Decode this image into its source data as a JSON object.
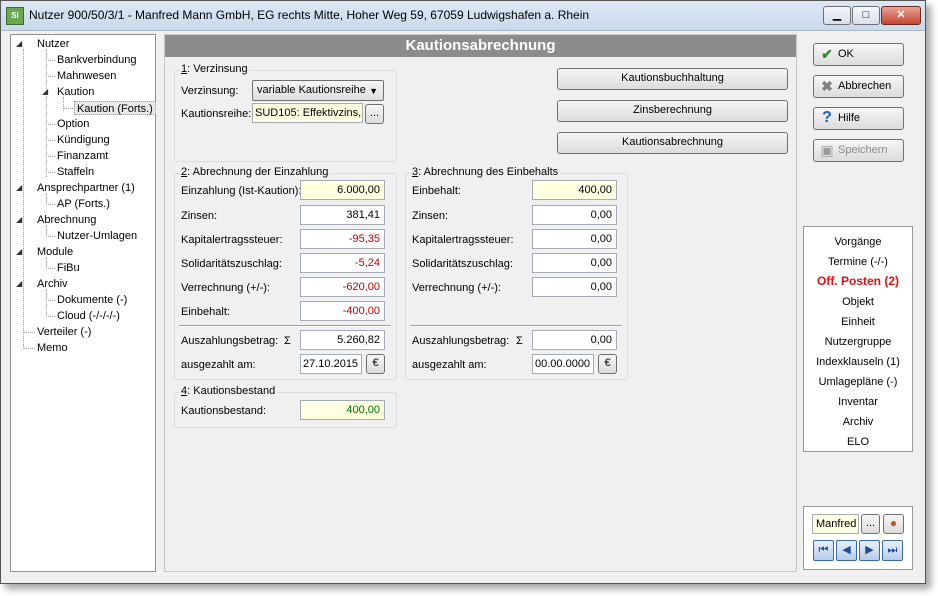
{
  "window": {
    "title": "Nutzer 900/50/3/1 - Manfred Mann GmbH, EG rechts Mitte, Hoher Weg 59, 67059 Ludwigshafen a. Rhein",
    "app_icon_text": "SI"
  },
  "tree": {
    "nutzer": "Nutzer",
    "bankverbindung": "Bankverbindung",
    "mahnwesen": "Mahnwesen",
    "kaution": "Kaution",
    "kaution_forts": "Kaution (Forts.)",
    "option": "Option",
    "kuendigung": "Kündigung",
    "finanzamt": "Finanzamt",
    "staffeln": "Staffeln",
    "ansprechpartner": "Ansprechpartner (1)",
    "ap_forts": "AP (Forts.)",
    "abrechnung": "Abrechnung",
    "nutzer_umlagen": "Nutzer-Umlagen",
    "module": "Module",
    "fibu": "FiBu",
    "archiv": "Archiv",
    "dokumente": "Dokumente (-)",
    "cloud": "Cloud (-/-/-/-)",
    "verteiler": "Verteiler (-)",
    "memo": "Memo"
  },
  "main": {
    "header": "Kautionsabrechnung",
    "verzinsung": {
      "num": "1",
      "title": ": Verzinsung",
      "verzinsung_label": "Verzinsung:",
      "verzinsung_value": "variable Kautionsreihe",
      "reihe_label": "Kautionsreihe:",
      "reihe_value": "SUD105: Effektivzins,",
      "browse": "..."
    },
    "buttons": {
      "buchhaltung": "Kautionsbuchhaltung",
      "zinsberechnung": "Zinsberechnung",
      "abrechnung": "Kautionsabrechnung"
    },
    "einzahlung": {
      "num": "2",
      "title": ": Abrechnung der Einzahlung",
      "einzahlung_label": "Einzahlung (Ist-Kaution):",
      "einzahlung_value": "6.000,00",
      "zinsen_label": "Zinsen:",
      "zinsen_value": "381,41",
      "kapst_label": "Kapitalertragssteuer:",
      "kapst_value": "-95,35",
      "soli_label": "Solidaritätszuschlag:",
      "soli_value": "-5,24",
      "verrechnung_label": "Verrechnung (+/-):",
      "verrechnung_value": "-620,00",
      "einbehalt_label": "Einbehalt:",
      "einbehalt_value": "-400,00",
      "auszahlung_label": "Auszahlungsbetrag:",
      "sigma": "Σ",
      "auszahlung_value": "5.260,82",
      "ausgezahlt_label": "ausgezahlt am:",
      "ausgezahlt_value": "27.10.2015",
      "euro": "€"
    },
    "einbehalt": {
      "num": "3",
      "title": ": Abrechnung des Einbehalts",
      "einbehalt_label": "Einbehalt:",
      "einbehalt_value": "400,00",
      "zinsen_label": "Zinsen:",
      "zinsen_value": "0,00",
      "kapst_label": "Kapitalertragssteuer:",
      "kapst_value": "0,00",
      "soli_label": "Solidaritätszuschlag:",
      "soli_value": "0,00",
      "verrechnung_label": "Verrechnung (+/-):",
      "verrechnung_value": "0,00",
      "auszahlung_label": "Auszahlungsbetrag:",
      "sigma": "Σ",
      "auszahlung_value": "0,00",
      "ausgezahlt_label": "ausgezahlt am:",
      "ausgezahlt_value": "00.00.0000",
      "euro": "€"
    },
    "bestand": {
      "num": "4",
      "title": ": Kautionsbestand",
      "label": "Kautionsbestand:",
      "value": "400,00"
    }
  },
  "actions": {
    "ok": "OK",
    "abbrechen": "Abbrechen",
    "hilfe": "Hilfe",
    "speichern": "Speichern"
  },
  "nav": {
    "items": [
      "Vorgänge",
      "Termine (-/-)",
      "Off. Posten (2)",
      "Objekt",
      "Einheit",
      "Nutzergruppe",
      "Indexklauseln (1)",
      "Umlagepläne (-)",
      "Inventar",
      "Archiv",
      "ELO"
    ],
    "active_index": 2
  },
  "user": {
    "name": "Manfred",
    "browse": "..."
  },
  "colors": {
    "header_bg": "#8c8c8c",
    "active_nav": "#e01010",
    "negative": "#c00000",
    "positive": "#007000",
    "input_yellow": "#ffffe1"
  }
}
